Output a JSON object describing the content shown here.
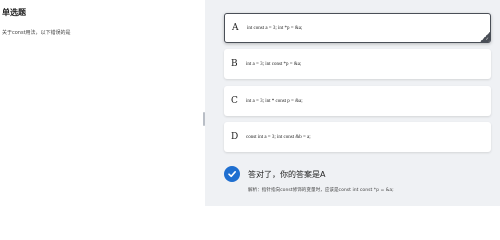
{
  "question": {
    "type_label": "单选题",
    "text": "关于const用法，以下错误的是"
  },
  "options": [
    {
      "letter": "A",
      "code": "int const a = 3; int *p = &a;"
    },
    {
      "letter": "B",
      "code": "int a = 3; int const *p = &a;"
    },
    {
      "letter": "C",
      "code": "int a = 3; int * const p = &a;"
    },
    {
      "letter": "D",
      "code": "const int a = 3; int const &b = a;"
    }
  ],
  "result": {
    "message": "答对了，你的答案是A",
    "explanation": "解析：指针指向const修饰的变量时，应该是const int const *p = &a;"
  },
  "colors": {
    "accent": "#1f6fd0",
    "right_panel_bg": "#eff1f4",
    "selected_border": "#4a4f57"
  },
  "icons": {
    "result": "check-circle-icon",
    "selected_corner": "check-icon"
  }
}
